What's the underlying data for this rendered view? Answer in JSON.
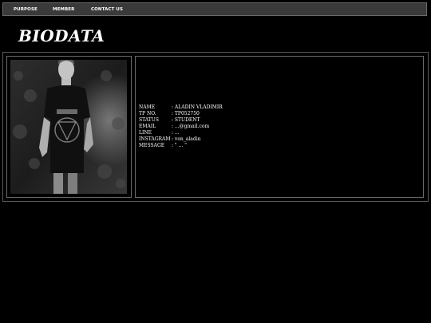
{
  "nav": {
    "items": [
      {
        "label": "PURPOSE"
      },
      {
        "label": "MEMBER"
      },
      {
        "label": "CONTACT US"
      }
    ]
  },
  "page_title": "BIODATA",
  "profile": {
    "photo_icon": "profile-photo",
    "rows": [
      {
        "label": "NAME",
        "value": ": ALADIN VLADIMIR"
      },
      {
        "label": "TP NO.",
        "value": ": TP052750"
      },
      {
        "label": "STATUS",
        "value": ": STUDENT"
      },
      {
        "label": "EMAIL",
        "value": ": ...@gmail.com"
      },
      {
        "label": "LINE",
        "value": ": ..."
      },
      {
        "label": "INSTAGRAM",
        "value": ": von_aladin"
      },
      {
        "label": "MESSAGE",
        "value": ": \" ... \""
      }
    ]
  }
}
